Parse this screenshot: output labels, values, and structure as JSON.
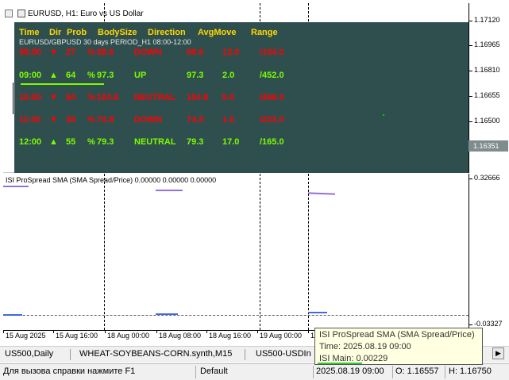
{
  "main": {
    "title": "EURUSD, H1:  Euro vs US Dollar",
    "price_ticks": [
      "1.17120",
      "1.16965",
      "1.16810",
      "1.16655",
      "1.16500",
      "1.16351"
    ],
    "current_price": "1.16351"
  },
  "panel": {
    "headers": [
      "Time",
      "Dir",
      "Prob",
      "BodySize",
      "Direction",
      "AvgMove",
      "Range"
    ],
    "subtitle": "EURUSD/GBPUSD 30 days PERIOD_H1 08:00-12:00",
    "rows": [
      {
        "time": "08:00",
        "dir": "▼",
        "prob": "27",
        "pct": "%",
        "body": "68.6",
        "direction": "DOWN",
        "avg": "68.6",
        "sd": "12.0",
        "range": "/164.0",
        "color": "red"
      },
      {
        "time": "09:00",
        "dir": "▲",
        "prob": "64",
        "pct": "%",
        "body": "97.3",
        "direction": "UP",
        "avg": "97.3",
        "sd": "2.0",
        "range": "/452.0",
        "color": "green"
      },
      {
        "time": "10:00",
        "dir": "▼",
        "prob": "50",
        "pct": "%",
        "body": "104.8",
        "direction": "NEUTRAL",
        "avg": "104.8",
        "sd": "9.0",
        "range": "/466.0",
        "color": "red"
      },
      {
        "time": "11:00",
        "dir": "▼",
        "prob": "36",
        "pct": "%",
        "body": "74.8",
        "direction": "DOWN",
        "avg": "74.8",
        "sd": "1.0",
        "range": "/223.0",
        "color": "red"
      },
      {
        "time": "12:00",
        "dir": "▲",
        "prob": "55",
        "pct": "%",
        "body": "79.3",
        "direction": "NEUTRAL",
        "avg": "79.3",
        "sd": "17.0",
        "range": "/165.0",
        "color": "green"
      }
    ]
  },
  "indicator": {
    "title": "ISI ProSpread SMA (SMA Spread/Price) 0.00000 0.00000 0.00000",
    "axis_top": "0.32666",
    "axis_bottom": "-0.03327"
  },
  "time_axis": [
    "15 Aug 2025",
    "15 Aug 16:00",
    "18 Aug 00:00",
    "18 Aug 08:00",
    "18 Aug 16:00",
    "19 Aug 00:00",
    "19"
  ],
  "tabs": [
    "US500,Daily",
    "WHEAT-SOYBEANS-CORN.synth,M15",
    "US500-USDIn"
  ],
  "status": {
    "help": "Для вызова справки нажмите F1",
    "profile": "Default",
    "datetime": "2025.08.19 09:00",
    "open": "O: 1.16557",
    "high": "H: 1.16750"
  },
  "tooltip": {
    "name": "ISI ProSpread SMA (SMA Spread/Price)",
    "time": "Time: 2025.08.19 09:00",
    "value": "ISI Main: 0.00229"
  },
  "colors": {
    "panel_bg": "#2f4f4f",
    "header": "#ffd700",
    "up": "#7cfc00",
    "down": "#ff0000",
    "line_main": "#9370db",
    "line_sig": "#4169e1"
  }
}
